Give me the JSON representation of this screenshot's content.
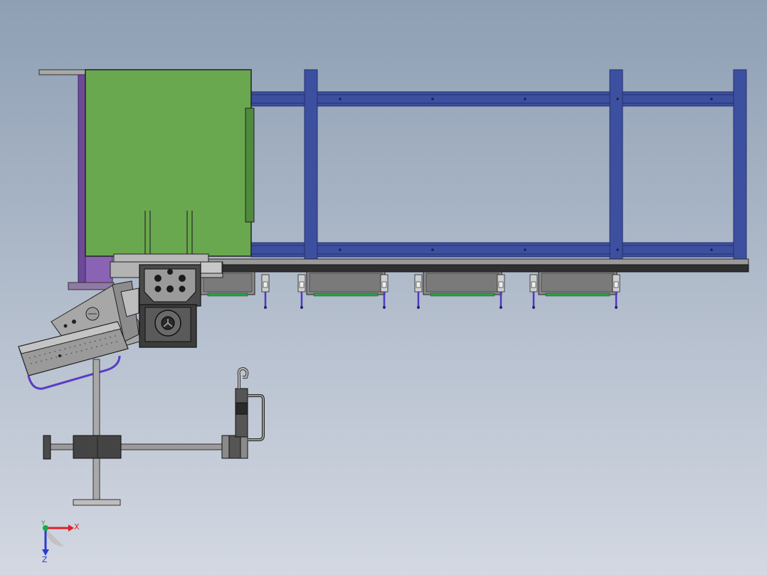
{
  "viewport": {
    "background_top": "#8e9fb4",
    "background_bottom": "#d3d8e2"
  },
  "colors": {
    "frame_blue": "#3d4f9f",
    "frame_blue_dark": "#22306e",
    "housing_green": "#6aa84f",
    "side_purple": "#8b63b5",
    "metal_gray": "#9c9c9c",
    "dark_gray": "#3a3a3a",
    "rail_dark": "#2f2f2f",
    "guide_green": "#2e9e4a",
    "axis_red": "#e0202a",
    "axis_green": "#16a84a",
    "axis_blue": "#2a3cd0"
  },
  "components": {
    "frame": "conveyor-frame",
    "housing": "machine-housing",
    "gearbox": "gearbox",
    "carriages": "linear-carriages",
    "stand": "support-stand",
    "hook": "lifting-hook"
  },
  "triad": {
    "x_label": "X",
    "y_label": "Y",
    "z_label": "Z"
  }
}
